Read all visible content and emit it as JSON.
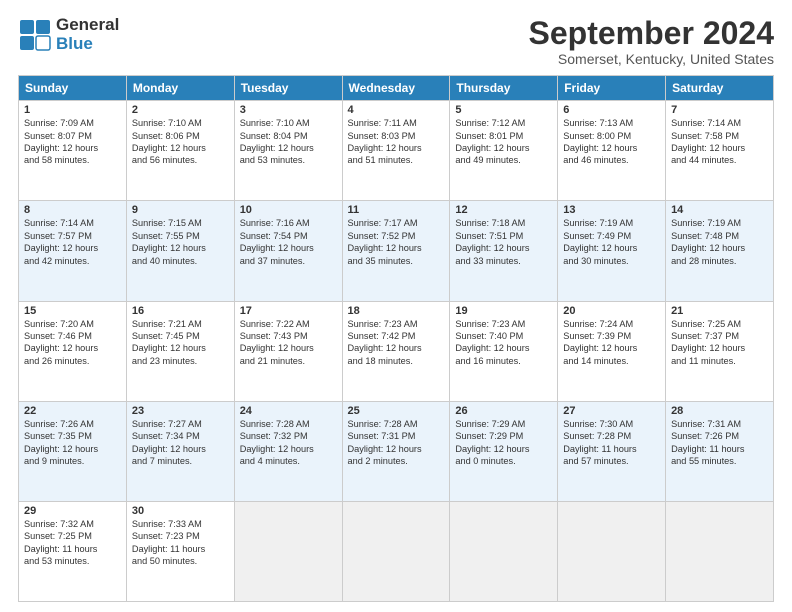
{
  "header": {
    "logo_line1": "General",
    "logo_line2": "Blue",
    "month_title": "September 2024",
    "location": "Somerset, Kentucky, United States"
  },
  "days_of_week": [
    "Sunday",
    "Monday",
    "Tuesday",
    "Wednesday",
    "Thursday",
    "Friday",
    "Saturday"
  ],
  "weeks": [
    [
      {
        "day": "1",
        "lines": [
          "Sunrise: 7:09 AM",
          "Sunset: 8:07 PM",
          "Daylight: 12 hours",
          "and 58 minutes."
        ]
      },
      {
        "day": "2",
        "lines": [
          "Sunrise: 7:10 AM",
          "Sunset: 8:06 PM",
          "Daylight: 12 hours",
          "and 56 minutes."
        ]
      },
      {
        "day": "3",
        "lines": [
          "Sunrise: 7:10 AM",
          "Sunset: 8:04 PM",
          "Daylight: 12 hours",
          "and 53 minutes."
        ]
      },
      {
        "day": "4",
        "lines": [
          "Sunrise: 7:11 AM",
          "Sunset: 8:03 PM",
          "Daylight: 12 hours",
          "and 51 minutes."
        ]
      },
      {
        "day": "5",
        "lines": [
          "Sunrise: 7:12 AM",
          "Sunset: 8:01 PM",
          "Daylight: 12 hours",
          "and 49 minutes."
        ]
      },
      {
        "day": "6",
        "lines": [
          "Sunrise: 7:13 AM",
          "Sunset: 8:00 PM",
          "Daylight: 12 hours",
          "and 46 minutes."
        ]
      },
      {
        "day": "7",
        "lines": [
          "Sunrise: 7:14 AM",
          "Sunset: 7:58 PM",
          "Daylight: 12 hours",
          "and 44 minutes."
        ]
      }
    ],
    [
      {
        "day": "8",
        "lines": [
          "Sunrise: 7:14 AM",
          "Sunset: 7:57 PM",
          "Daylight: 12 hours",
          "and 42 minutes."
        ]
      },
      {
        "day": "9",
        "lines": [
          "Sunrise: 7:15 AM",
          "Sunset: 7:55 PM",
          "Daylight: 12 hours",
          "and 40 minutes."
        ]
      },
      {
        "day": "10",
        "lines": [
          "Sunrise: 7:16 AM",
          "Sunset: 7:54 PM",
          "Daylight: 12 hours",
          "and 37 minutes."
        ]
      },
      {
        "day": "11",
        "lines": [
          "Sunrise: 7:17 AM",
          "Sunset: 7:52 PM",
          "Daylight: 12 hours",
          "and 35 minutes."
        ]
      },
      {
        "day": "12",
        "lines": [
          "Sunrise: 7:18 AM",
          "Sunset: 7:51 PM",
          "Daylight: 12 hours",
          "and 33 minutes."
        ]
      },
      {
        "day": "13",
        "lines": [
          "Sunrise: 7:19 AM",
          "Sunset: 7:49 PM",
          "Daylight: 12 hours",
          "and 30 minutes."
        ]
      },
      {
        "day": "14",
        "lines": [
          "Sunrise: 7:19 AM",
          "Sunset: 7:48 PM",
          "Daylight: 12 hours",
          "and 28 minutes."
        ]
      }
    ],
    [
      {
        "day": "15",
        "lines": [
          "Sunrise: 7:20 AM",
          "Sunset: 7:46 PM",
          "Daylight: 12 hours",
          "and 26 minutes."
        ]
      },
      {
        "day": "16",
        "lines": [
          "Sunrise: 7:21 AM",
          "Sunset: 7:45 PM",
          "Daylight: 12 hours",
          "and 23 minutes."
        ]
      },
      {
        "day": "17",
        "lines": [
          "Sunrise: 7:22 AM",
          "Sunset: 7:43 PM",
          "Daylight: 12 hours",
          "and 21 minutes."
        ]
      },
      {
        "day": "18",
        "lines": [
          "Sunrise: 7:23 AM",
          "Sunset: 7:42 PM",
          "Daylight: 12 hours",
          "and 18 minutes."
        ]
      },
      {
        "day": "19",
        "lines": [
          "Sunrise: 7:23 AM",
          "Sunset: 7:40 PM",
          "Daylight: 12 hours",
          "and 16 minutes."
        ]
      },
      {
        "day": "20",
        "lines": [
          "Sunrise: 7:24 AM",
          "Sunset: 7:39 PM",
          "Daylight: 12 hours",
          "and 14 minutes."
        ]
      },
      {
        "day": "21",
        "lines": [
          "Sunrise: 7:25 AM",
          "Sunset: 7:37 PM",
          "Daylight: 12 hours",
          "and 11 minutes."
        ]
      }
    ],
    [
      {
        "day": "22",
        "lines": [
          "Sunrise: 7:26 AM",
          "Sunset: 7:35 PM",
          "Daylight: 12 hours",
          "and 9 minutes."
        ]
      },
      {
        "day": "23",
        "lines": [
          "Sunrise: 7:27 AM",
          "Sunset: 7:34 PM",
          "Daylight: 12 hours",
          "and 7 minutes."
        ]
      },
      {
        "day": "24",
        "lines": [
          "Sunrise: 7:28 AM",
          "Sunset: 7:32 PM",
          "Daylight: 12 hours",
          "and 4 minutes."
        ]
      },
      {
        "day": "25",
        "lines": [
          "Sunrise: 7:28 AM",
          "Sunset: 7:31 PM",
          "Daylight: 12 hours",
          "and 2 minutes."
        ]
      },
      {
        "day": "26",
        "lines": [
          "Sunrise: 7:29 AM",
          "Sunset: 7:29 PM",
          "Daylight: 12 hours",
          "and 0 minutes."
        ]
      },
      {
        "day": "27",
        "lines": [
          "Sunrise: 7:30 AM",
          "Sunset: 7:28 PM",
          "Daylight: 11 hours",
          "and 57 minutes."
        ]
      },
      {
        "day": "28",
        "lines": [
          "Sunrise: 7:31 AM",
          "Sunset: 7:26 PM",
          "Daylight: 11 hours",
          "and 55 minutes."
        ]
      }
    ],
    [
      {
        "day": "29",
        "lines": [
          "Sunrise: 7:32 AM",
          "Sunset: 7:25 PM",
          "Daylight: 11 hours",
          "and 53 minutes."
        ]
      },
      {
        "day": "30",
        "lines": [
          "Sunrise: 7:33 AM",
          "Sunset: 7:23 PM",
          "Daylight: 11 hours",
          "and 50 minutes."
        ]
      },
      {
        "day": "",
        "lines": []
      },
      {
        "day": "",
        "lines": []
      },
      {
        "day": "",
        "lines": []
      },
      {
        "day": "",
        "lines": []
      },
      {
        "day": "",
        "lines": []
      }
    ]
  ]
}
